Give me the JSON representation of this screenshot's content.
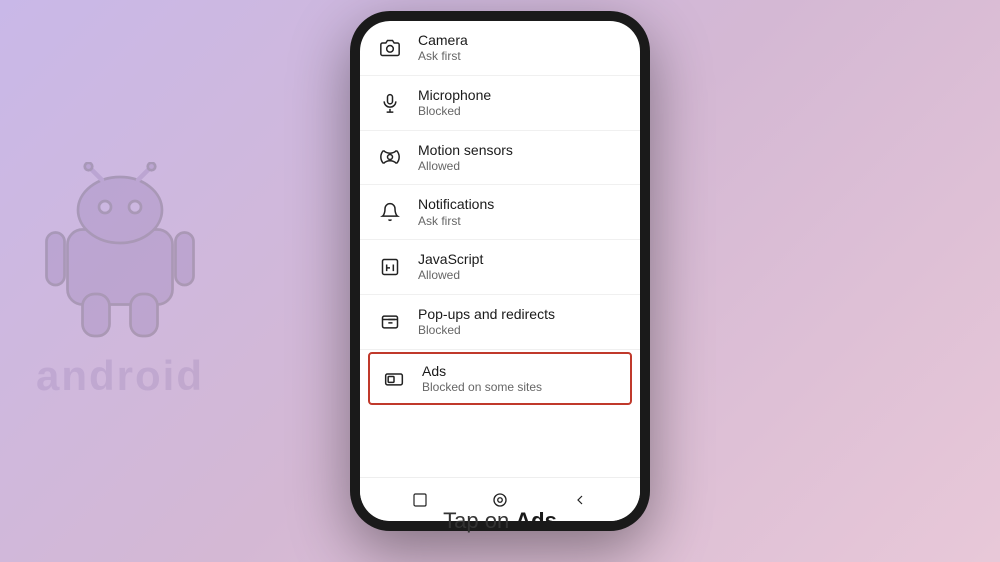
{
  "background": {
    "gradient_start": "#c9b8e8",
    "gradient_end": "#e8c8d8"
  },
  "android_watermark": {
    "text": "android"
  },
  "phone": {
    "settings_items": [
      {
        "id": "camera",
        "title": "Camera",
        "subtitle": "Ask first",
        "icon": "camera-icon",
        "highlighted": false
      },
      {
        "id": "microphone",
        "title": "Microphone",
        "subtitle": "Blocked",
        "icon": "microphone-icon",
        "highlighted": false
      },
      {
        "id": "motion-sensors",
        "title": "Motion sensors",
        "subtitle": "Allowed",
        "icon": "motion-icon",
        "highlighted": false
      },
      {
        "id": "notifications",
        "title": "Notifications",
        "subtitle": "Ask first",
        "icon": "bell-icon",
        "highlighted": false
      },
      {
        "id": "javascript",
        "title": "JavaScript",
        "subtitle": "Allowed",
        "icon": "javascript-icon",
        "highlighted": false
      },
      {
        "id": "popups",
        "title": "Pop-ups and redirects",
        "subtitle": "Blocked",
        "icon": "popup-icon",
        "highlighted": false
      },
      {
        "id": "ads",
        "title": "Ads",
        "subtitle": "Blocked on some sites",
        "icon": "ads-icon",
        "highlighted": true
      }
    ]
  },
  "caption": {
    "prefix": "Tap on ",
    "bold": "Ads"
  },
  "arrow": "→"
}
